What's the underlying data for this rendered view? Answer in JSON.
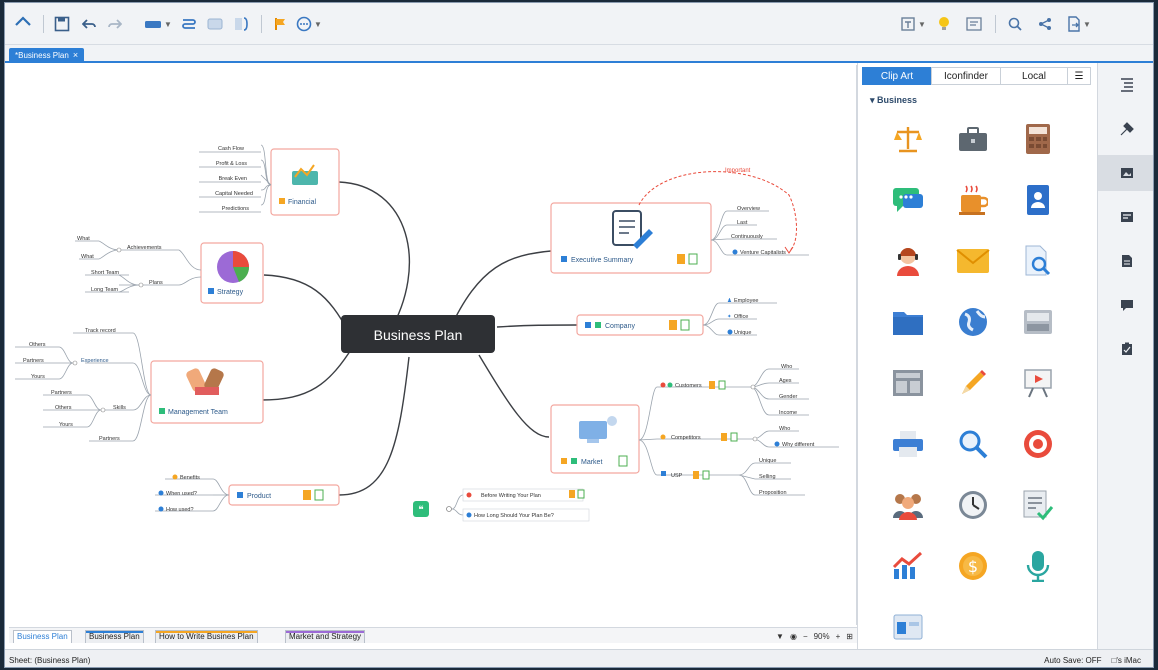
{
  "doc_tab": {
    "title": "*Business Plan",
    "close": "×"
  },
  "mindmap": {
    "central": "Business Plan",
    "financial": {
      "label": "Financial",
      "items": [
        "Cash Flow",
        "Profit & Loss",
        "Break Even",
        "Capital Needed",
        "Predictions"
      ]
    },
    "strategy": {
      "label": "Strategy",
      "achievements": "Achievements",
      "plans": "Plans",
      "what1": "What",
      "what2": "What",
      "short_term": "Short Team",
      "long_term": "Long Team"
    },
    "management": {
      "label": "Management Team",
      "track_record": "Track record",
      "experience": "Experience",
      "skills": "Skills",
      "partners": "Partners",
      "others1": "Others",
      "partners1": "Partners",
      "yours1": "Yours",
      "partners2": "Partners",
      "others2": "Others",
      "yours2": "Yours"
    },
    "product": {
      "label": "Product",
      "benefits": "Benefits",
      "when_used": "When used?",
      "how_used": "How used?"
    },
    "executive": {
      "label": "Executive Summary",
      "items": [
        "Overview",
        "Last",
        "Continuously",
        "Venture Capitalists"
      ],
      "important": "Important"
    },
    "company": {
      "label": "Company",
      "items": [
        "Employee",
        "Office",
        "Unique"
      ]
    },
    "market": {
      "label": "Market",
      "customers": "Customers",
      "competitors": "Competitors",
      "usp": "USP",
      "cust_items": [
        "Who",
        "Ages",
        "Gender",
        "Income"
      ],
      "comp_items": [
        "Who",
        "Why different"
      ],
      "usp_items": [
        "Unique",
        "Selling",
        "Proposition"
      ]
    },
    "floating": {
      "before": "Before Writing Your Plan",
      "how_long": "How Long Should Your Plan Be?"
    }
  },
  "sheets": {
    "tabs": [
      "Business Plan",
      "Business Plan",
      "How to Write Busines Plan",
      "Market and Strategy"
    ],
    "zoom": "90%"
  },
  "status": {
    "sheet": "Sheet: (Business Plan)",
    "autosave": "Auto Save: OFF",
    "user": "□'s iMac"
  },
  "panel": {
    "tabs": [
      "Clip Art",
      "Iconfinder",
      "Local"
    ],
    "category": "Business",
    "icons": [
      "scales-icon",
      "briefcase-icon",
      "calculator-icon",
      "chat-icon",
      "coffee-icon",
      "contact-book-icon",
      "support-agent-icon",
      "envelope-icon",
      "document-search-icon",
      "folder-icon",
      "globe-icon",
      "inbox-icon",
      "layout-icon",
      "pencil-icon",
      "presentation-icon",
      "printer-icon",
      "magnifier-icon",
      "target-icon",
      "team-icon",
      "clock-icon",
      "signed-document-icon",
      "growth-chart-icon",
      "coin-icon",
      "microphone-icon",
      "window-icon"
    ]
  },
  "colors": {
    "accent": "#2d7fd6",
    "central": "#2e3034",
    "node_border": "#f3a79f",
    "orange": "#f5a623"
  }
}
